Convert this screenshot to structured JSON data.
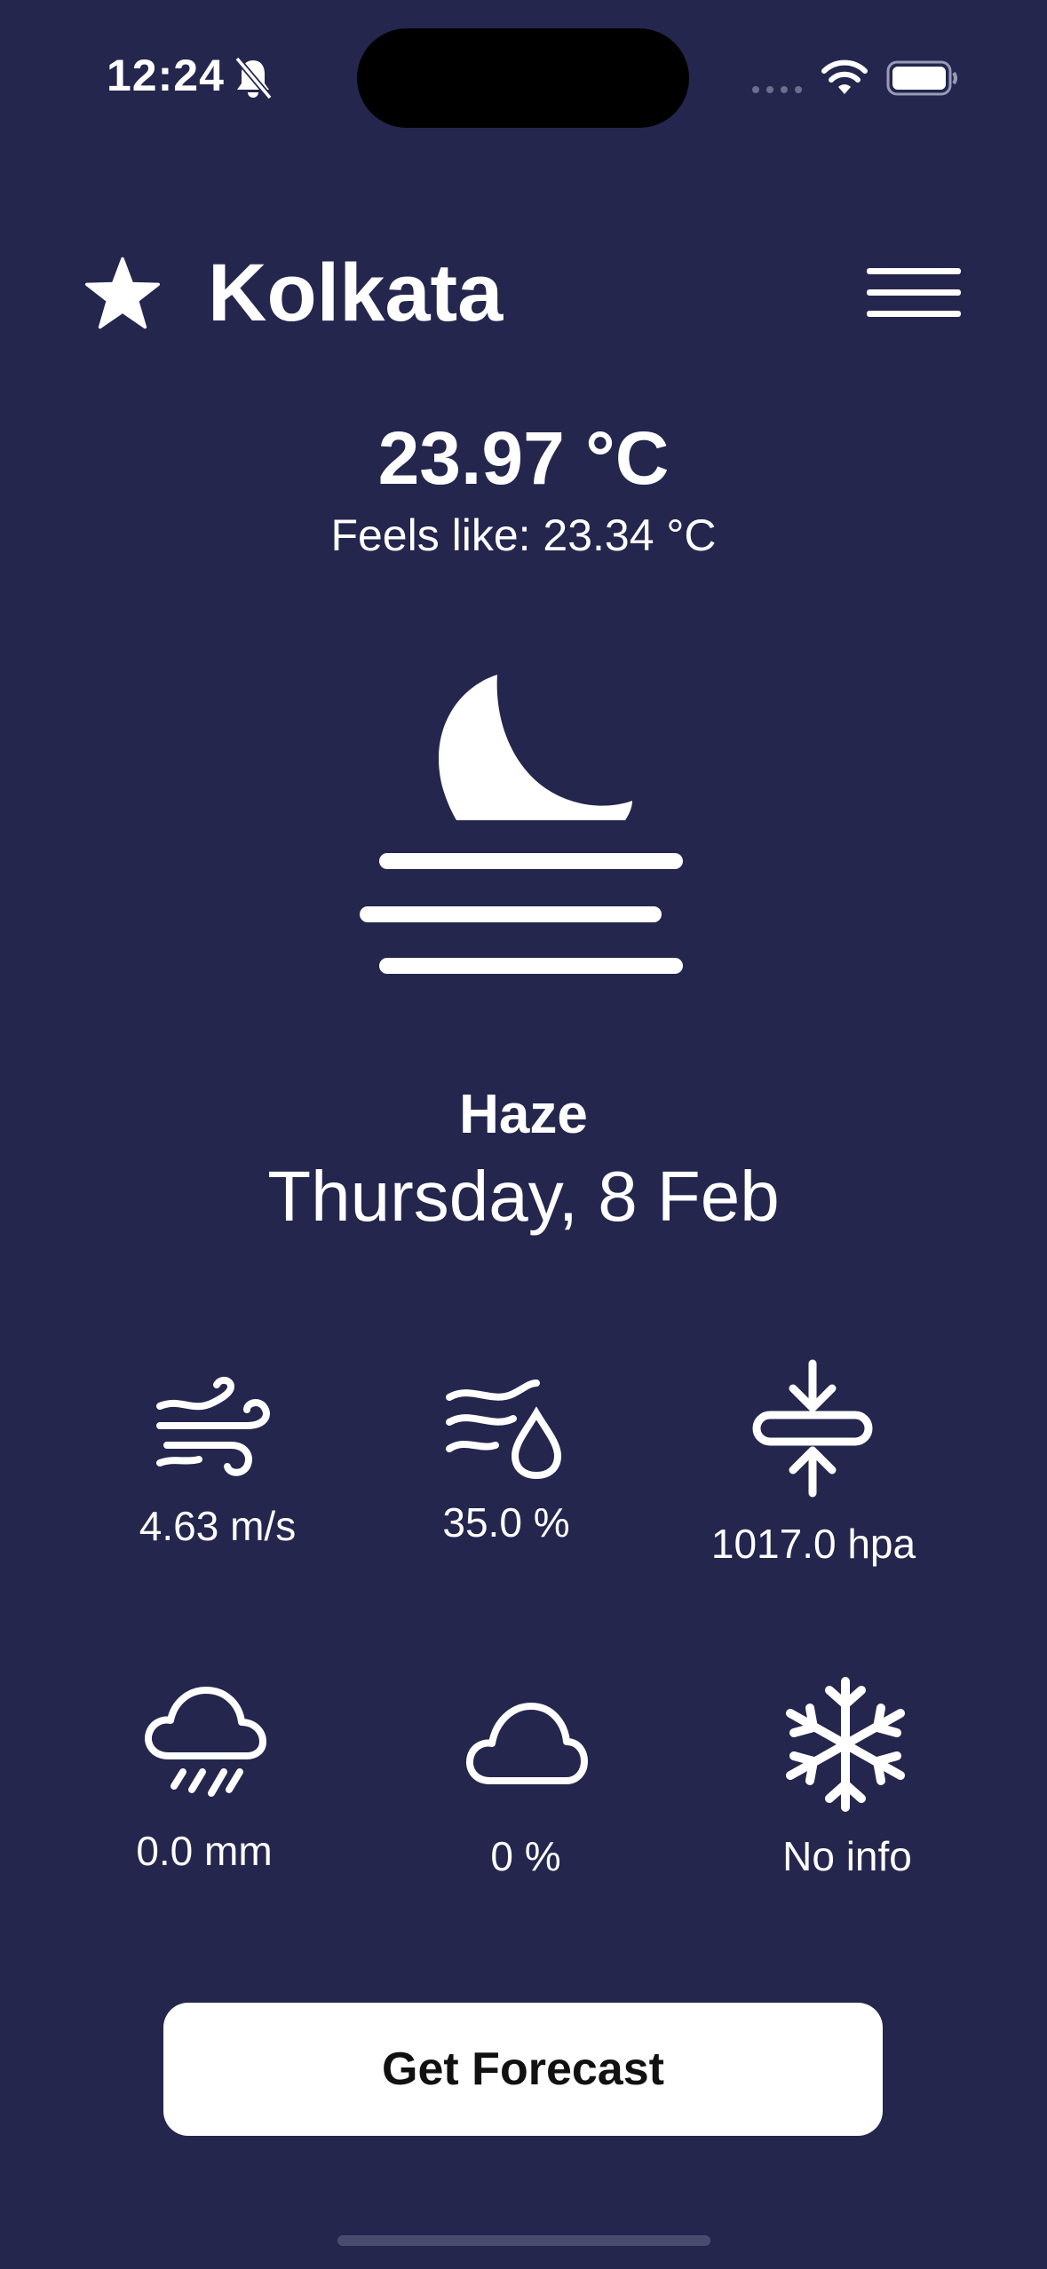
{
  "status_bar": {
    "time": "12:24",
    "icons": [
      "silent-mode-icon",
      "cellular-signal-icon",
      "wifi-icon",
      "battery-icon"
    ]
  },
  "header": {
    "city": "Kolkata",
    "favorite_icon": "star-icon",
    "menu_icon": "hamburger-menu-icon"
  },
  "current": {
    "temperature": "23.97 °C",
    "feels_like": "Feels like: 23.34 °C",
    "condition_icon": "haze-night-icon",
    "condition": "Haze",
    "date": "Thursday, 8 Feb"
  },
  "metrics": [
    {
      "icon": "wind-icon",
      "value": "4.63 m/s"
    },
    {
      "icon": "humidity-icon",
      "value": "35.0 %"
    },
    {
      "icon": "pressure-icon",
      "value": "1017.0 hpa"
    },
    {
      "icon": "rain-cloud-icon",
      "value": "0.0 mm"
    },
    {
      "icon": "cloud-icon",
      "value": "0 %"
    },
    {
      "icon": "snowflake-icon",
      "value": "No info"
    }
  ],
  "actions": {
    "forecast_button": "Get Forecast"
  },
  "colors": {
    "background": "#24264e",
    "foreground": "#ffffff",
    "button_background": "#ffffff",
    "button_text": "#111111"
  }
}
